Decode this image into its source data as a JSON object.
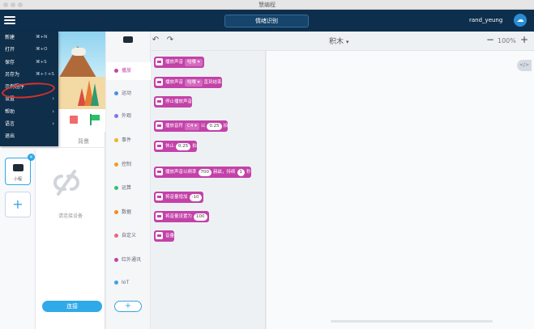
{
  "window": {
    "title": "慧编程"
  },
  "header": {
    "project_name": "情绪识别",
    "username": "rand_yeung",
    "avatar_icon": "cloud-icon"
  },
  "file_menu": {
    "items": [
      {
        "label": "新建",
        "shortcut": "⌘+N",
        "has_submenu": false
      },
      {
        "label": "打开",
        "shortcut": "⌘+O",
        "has_submenu": false
      },
      {
        "label": "保存",
        "shortcut": "⌘+S",
        "has_submenu": false
      },
      {
        "label": "另存为",
        "shortcut": "⌘+⇧+S",
        "has_submenu": false
      },
      {
        "label": "示例程序",
        "shortcut": "",
        "has_submenu": false
      },
      {
        "label": "设置",
        "shortcut": "",
        "has_submenu": true
      },
      {
        "label": "帮助",
        "shortcut": "",
        "has_submenu": true
      },
      {
        "label": "语言",
        "shortcut": "",
        "has_submenu": true
      },
      {
        "label": "退出",
        "shortcut": "",
        "has_submenu": false
      }
    ],
    "highlighted": "示例程序"
  },
  "stage": {
    "tab_background": "背景"
  },
  "devices": {
    "selected_device_label": "小程",
    "empty_text": "请连接设备",
    "connect_button": "连接"
  },
  "categories": [
    {
      "label": "播放",
      "color": "#c342a8",
      "active": true
    },
    {
      "label": "运动",
      "color": "#4a8ee8",
      "active": false
    },
    {
      "label": "外观",
      "color": "#8f6fe0",
      "active": false
    },
    {
      "label": "事件",
      "color": "#f0b429",
      "active": false
    },
    {
      "label": "控制",
      "color": "#f29a2e",
      "active": false
    },
    {
      "label": "运算",
      "color": "#3bbf6e",
      "active": false
    },
    {
      "label": "数据",
      "color": "#f08c2a",
      "active": false
    },
    {
      "label": "自定义",
      "color": "#e46a7c",
      "active": false
    },
    {
      "label": "红外通讯",
      "color": "#c342a8",
      "active": false
    },
    {
      "label": "IoT",
      "color": "#3aa4e0",
      "active": false
    }
  ],
  "toolbar": {
    "mode": "积木",
    "zoom": "100%"
  },
  "blocks": [
    {
      "parts": [
        {
          "t": "txt",
          "v": "播放声音"
        },
        {
          "t": "drop",
          "v": "哈喽 ▾"
        }
      ]
    },
    {
      "parts": [
        {
          "t": "txt",
          "v": "播放声音"
        },
        {
          "t": "drop",
          "v": "哈喽 ▾"
        },
        {
          "t": "txt",
          "v": "直到结束"
        }
      ]
    },
    {
      "parts": [
        {
          "t": "txt",
          "v": "停止播放声音"
        }
      ]
    },
    {
      "parts": [
        {
          "t": "txt",
          "v": "播放音符"
        },
        {
          "t": "drop",
          "v": "C4 ▾"
        },
        {
          "t": "txt",
          "v": "以"
        },
        {
          "t": "pill",
          "v": "0.25"
        },
        {
          "t": "txt",
          "v": "拍"
        }
      ]
    },
    {
      "parts": [
        {
          "t": "txt",
          "v": "休止"
        },
        {
          "t": "pill",
          "v": "0.25"
        },
        {
          "t": "txt",
          "v": "拍"
        }
      ]
    },
    {
      "parts": [
        {
          "t": "txt",
          "v": "播放声音以频率"
        },
        {
          "t": "pill",
          "v": "700"
        },
        {
          "t": "txt",
          "v": "赫兹，持续"
        },
        {
          "t": "pill",
          "v": "1"
        },
        {
          "t": "txt",
          "v": "秒"
        }
      ]
    },
    {
      "parts": [
        {
          "t": "txt",
          "v": "将音量增加"
        },
        {
          "t": "pill",
          "v": "-10"
        }
      ]
    },
    {
      "parts": [
        {
          "t": "txt",
          "v": "将音量设置为"
        },
        {
          "t": "pill",
          "v": "100"
        }
      ]
    },
    {
      "parts": [
        {
          "t": "txt",
          "v": "音量"
        }
      ]
    }
  ],
  "workspace": {
    "code_toggle": "</>"
  }
}
